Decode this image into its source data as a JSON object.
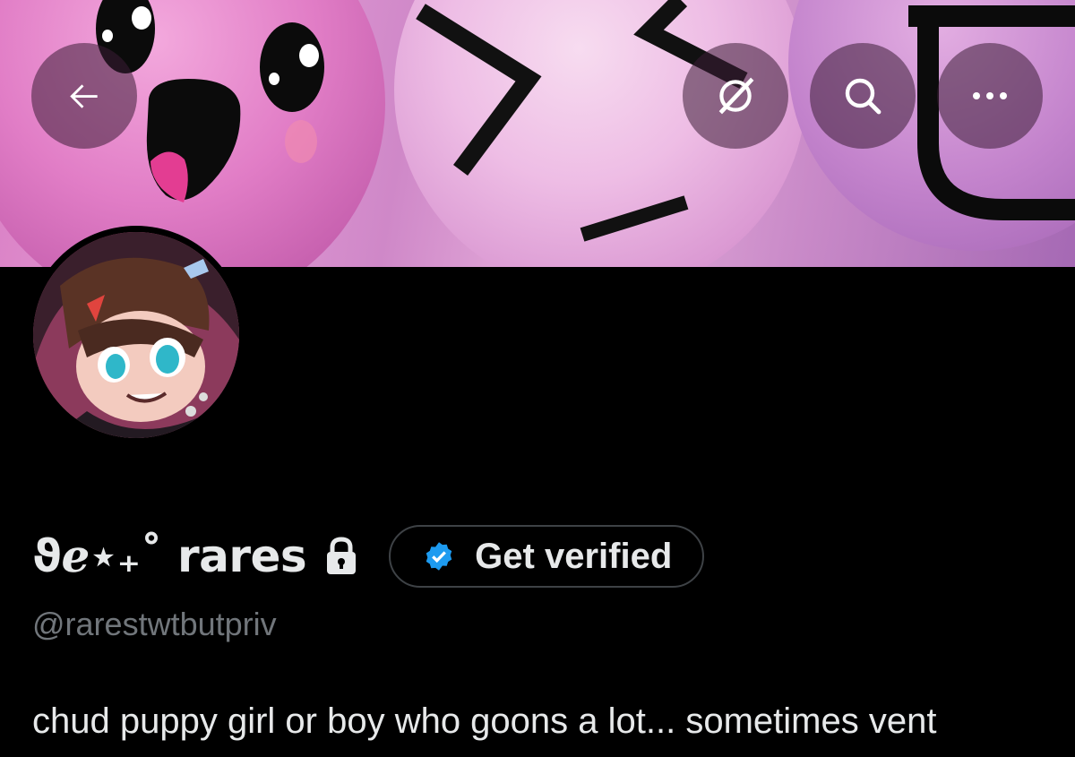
{
  "profile": {
    "display_name": "ϑℯ⋆₊˚ rares",
    "handle": "@rarestwtbutpriv",
    "bio": "chud puppy girl or boy who goons a lot... sometimes vent",
    "get_verified_label": "Get verified"
  },
  "header": {
    "back": "arrow-left-icon",
    "grok": "grok-icon",
    "search": "search-icon",
    "more": "more-icon"
  },
  "colors": {
    "background": "#000000",
    "text_primary": "#e7e9ea",
    "text_secondary": "#71767b",
    "verified_blue": "#1d9bf0",
    "button_overlay": "#4a2a44"
  }
}
